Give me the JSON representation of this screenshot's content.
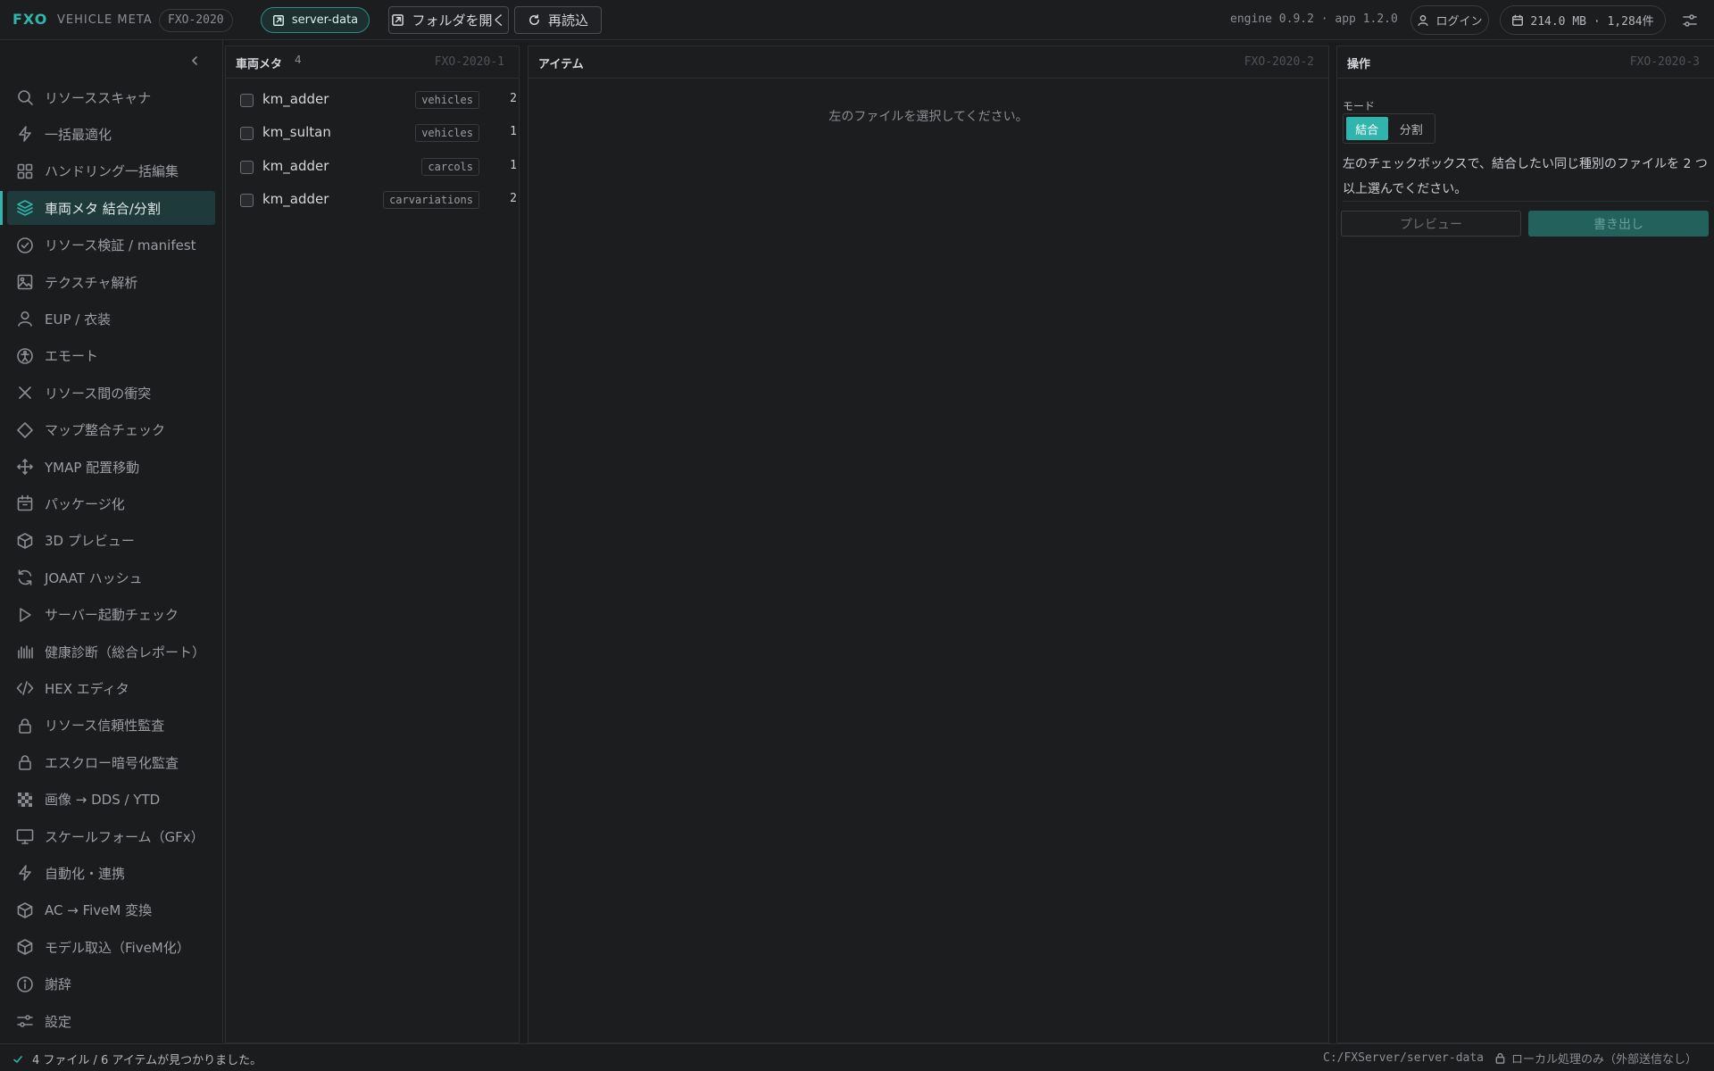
{
  "header": {
    "brand": "FXO",
    "app_title": "VEHICLE META",
    "app_code": "FXO-2020",
    "server": {
      "label": "server-data",
      "icon": "folder-link-icon"
    },
    "open_folder_label": "フォルダを開く",
    "reload_label": "再読込",
    "engine_info": "engine 0.9.2 · app 1.2.0",
    "login_label": "ログイン",
    "storage_info": "214.0 MB · 1,284件"
  },
  "sidebar": {
    "items": [
      {
        "label": "リソーススキャナ",
        "icon": "search-icon"
      },
      {
        "label": "一括最適化",
        "icon": "lightning-icon"
      },
      {
        "label": "ハンドリング一括編集",
        "icon": "grid-icon"
      },
      {
        "label": "車両メタ 結合/分割",
        "icon": "layers-icon",
        "active": true
      },
      {
        "label": "リソース検証 / manifest",
        "icon": "check-circle-icon"
      },
      {
        "label": "テクスチャ解析",
        "icon": "image-icon"
      },
      {
        "label": "EUP / 衣装",
        "icon": "user-icon"
      },
      {
        "label": "エモート",
        "icon": "accessibility-icon"
      },
      {
        "label": "リソース間の衝突",
        "icon": "x-icon"
      },
      {
        "label": "マップ整合チェック",
        "icon": "diamond-icon"
      },
      {
        "label": "YMAP 配置移動",
        "icon": "move-icon"
      },
      {
        "label": "パッケージ化",
        "icon": "package-icon"
      },
      {
        "label": "3D プレビュー",
        "icon": "cube-icon"
      },
      {
        "label": "JOAAT ハッシュ",
        "icon": "refresh-icon"
      },
      {
        "label": "サーバー起動チェック",
        "icon": "play-icon"
      },
      {
        "label": "健康診断（総合レポート）",
        "icon": "bars-icon"
      },
      {
        "label": "HEX エディタ",
        "icon": "code-icon"
      },
      {
        "label": "リソース信頼性監査",
        "icon": "lock-icon"
      },
      {
        "label": "エスクロー暗号化監査",
        "icon": "lock-icon"
      },
      {
        "label": "画像 → DDS / YTD",
        "icon": "checker-icon"
      },
      {
        "label": "スケールフォーム（GFx）",
        "icon": "monitor-icon"
      },
      {
        "label": "自動化・連携",
        "icon": "lightning-icon"
      },
      {
        "label": "AC → FiveM 変換",
        "icon": "cube-icon"
      },
      {
        "label": "モデル取込（FiveM化）",
        "icon": "cube-icon"
      },
      {
        "label": "謝辞",
        "icon": "info-icon"
      },
      {
        "label": "設定",
        "icon": "sliders-icon"
      }
    ]
  },
  "files_panel": {
    "title": "車両メタ",
    "count": "4",
    "code": "FXO-2020-1",
    "rows": [
      {
        "name": "km_adder",
        "type": "vehicles",
        "count": "2"
      },
      {
        "name": "km_sultan",
        "type": "vehicles",
        "count": "1"
      },
      {
        "name": "km_adder",
        "type": "carcols",
        "count": "1"
      },
      {
        "name": "km_adder",
        "type": "carvariations",
        "count": "2"
      }
    ]
  },
  "items_panel": {
    "title": "アイテム",
    "code": "FXO-2020-2",
    "empty_message": "左のファイルを選択してください。"
  },
  "ops_panel": {
    "title": "操作",
    "code": "FXO-2020-3",
    "mode_label": "モード",
    "mode_merge": "結合",
    "mode_split": "分割",
    "description": "左のチェックボックスで、結合したい同じ種別のファイルを 2 つ以上選んでください。",
    "preview_label": "プレビュー",
    "export_label": "書き出し"
  },
  "status": {
    "message": "4 ファイル / 6 アイテムが見つかりました。",
    "path": "C:/FXServer/server-data",
    "local_note": "ローカル処理のみ（外部送信なし）"
  },
  "colors": {
    "accent": "#2fb5ab",
    "background": "#1a1b1d",
    "active_item": "#1f3a3a",
    "export_button": "#23615c"
  }
}
